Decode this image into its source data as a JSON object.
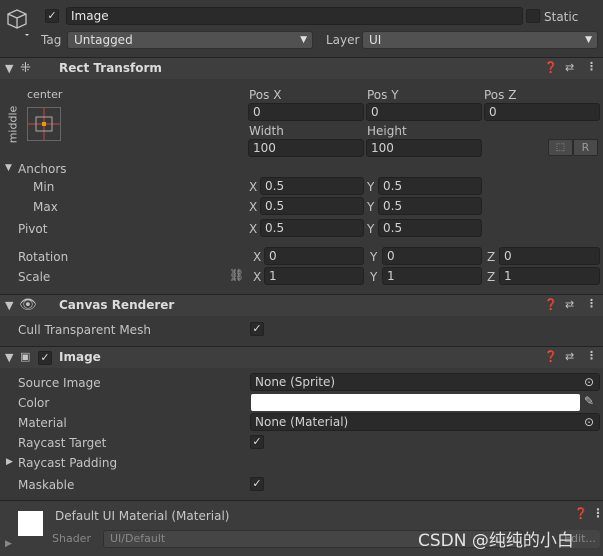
{
  "header": {
    "name": "Image",
    "active": true,
    "static_label": "Static",
    "static": false,
    "tag_label": "Tag",
    "tag": "Untagged",
    "layer_label": "Layer",
    "layer": "UI"
  },
  "rect_transform": {
    "title": "Rect Transform",
    "anchor_h": "center",
    "anchor_v": "middle",
    "pos_x_label": "Pos X",
    "pos_y_label": "Pos Y",
    "pos_z_label": "Pos Z",
    "pos_x": "0",
    "pos_y": "0",
    "pos_z": "0",
    "width_label": "Width",
    "height_label": "Height",
    "width": "100",
    "height": "100",
    "r_button": "R",
    "anchors_label": "Anchors",
    "min_label": "Min",
    "max_label": "Max",
    "pivot_label": "Pivot",
    "min_x": "0.5",
    "min_y": "0.5",
    "max_x": "0.5",
    "max_y": "0.5",
    "pivot_x": "0.5",
    "pivot_y": "0.5",
    "rotation_label": "Rotation",
    "scale_label": "Scale",
    "rot_x": "0",
    "rot_y": "0",
    "rot_z": "0",
    "scale_x": "1",
    "scale_y": "1",
    "scale_z": "1",
    "x": "X",
    "y": "Y",
    "z": "Z"
  },
  "canvas_renderer": {
    "title": "Canvas Renderer",
    "cull_label": "Cull Transparent Mesh",
    "cull": true
  },
  "image": {
    "title": "Image",
    "enabled": true,
    "source_label": "Source Image",
    "source": "None (Sprite)",
    "color_label": "Color",
    "color": "#ffffff",
    "material_label": "Material",
    "material": "None (Material)",
    "raycast_target_label": "Raycast Target",
    "raycast_target": true,
    "raycast_padding_label": "Raycast Padding",
    "maskable_label": "Maskable",
    "maskable": true
  },
  "material": {
    "name": "Default UI Material (Material)",
    "shader_label": "Shader",
    "shader": "UI/Default",
    "edit": "Edit..."
  },
  "watermark": "CSDN @纯纯的小白"
}
